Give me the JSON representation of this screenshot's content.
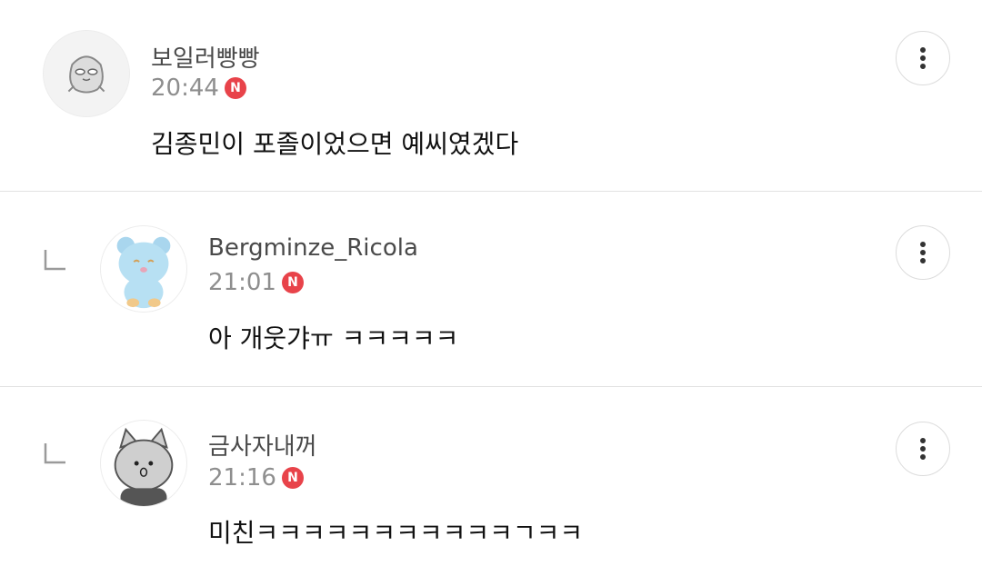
{
  "comments": [
    {
      "author": "보일러빵빵",
      "time": "20:44",
      "badge": "N",
      "text": "김종민이 포졸이었으면 예씨였겠다",
      "avatar_icon": "cartoon-character-avatar",
      "is_reply": false
    },
    {
      "author": "Bergminze_Ricola",
      "time": "21:01",
      "badge": "N",
      "text": "아 개웃갸ㅠ ㅋㅋㅋㅋㅋ",
      "avatar_icon": "blue-plush-bear-avatar",
      "is_reply": true
    },
    {
      "author": "금사자내꺼",
      "time": "21:16",
      "badge": "N",
      "text": "미친ㅋㅋㅋㅋㅋㅋㅋㅋㅋㅋㅋㄱㅋㅋ",
      "avatar_icon": "gray-cat-avatar",
      "is_reply": true
    }
  ],
  "colors": {
    "badge": "#e8434a",
    "divider": "#e2e2e2",
    "meta_text": "#8e8e8e"
  }
}
